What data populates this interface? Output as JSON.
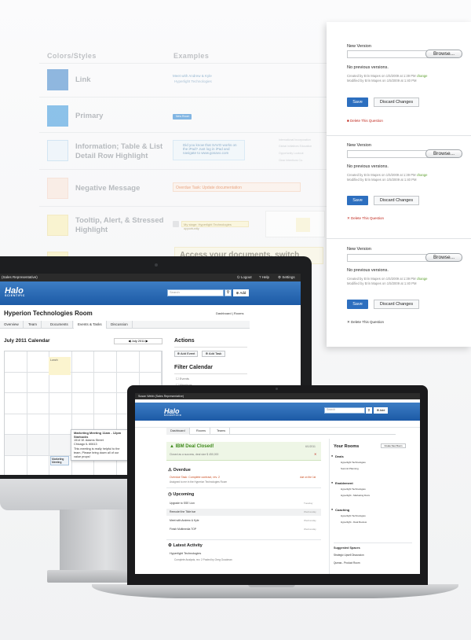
{
  "style_guide": {
    "col_colors": "Colors/Styles",
    "col_examples": "Examples",
    "rows": [
      {
        "name": "Link",
        "color": "#4f8fcf"
      },
      {
        "name": "Primary",
        "color": "#4aa0df"
      },
      {
        "name": "Information; Table & List\nDetail Row Highlight",
        "color": "#eaf4fb"
      },
      {
        "name": "Negative Message",
        "color": "#fbe7dc"
      },
      {
        "name": "Tooltip, Alert, & Stressed\nHighlight",
        "color": "#fbf1b8"
      }
    ],
    "link_example": "Meet with Andrew & Kyle",
    "link_sub": "Hyperlight Technologies",
    "primary_btn": "New Room",
    "info_text": "Did you know that SAVO works on the iPad? Just log in iPad and navigate to www.gosavo.com",
    "overdue_text": "Overdue Task: Update documentation",
    "tooltip_text": "My stage: Hyperlight Technologies opportunity",
    "doc_text": "Access your documents, switch",
    "mini_list": [
      "International Incorporation",
      "Global Initiatives Education",
      "Opportunity Lookout",
      "Clear Intentions Co."
    ]
  },
  "versions_panel": {
    "sections": [
      {
        "label": "New Version",
        "browse": "Browse...",
        "no_prev": "No previous versions.",
        "created": "Created by Erin Mapes on 1/5/2009 at 1:39 PM",
        "change": "change",
        "modified": "Modified by Erin Mapes on 1/5/2009 at 1:40 PM",
        "save": "Save",
        "discard": "Discard Changes",
        "delete": "Delete This Question",
        "delete_color": "#c0281d"
      },
      {
        "label": "New Version",
        "browse": "Browse...",
        "no_prev": "No previous versions.",
        "created": "Created by Erin Mapes on 1/5/2009 at 1:39 PM",
        "change": "change",
        "modified": "Modified by Erin Mapes on 1/5/2009 at 1:40 PM",
        "save": "Save",
        "discard": "Discard Changes",
        "delete": "Delete This Question",
        "delete_color": "#c0281d"
      },
      {
        "label": "New Version",
        "browse": "Browse...",
        "no_prev": "No previous versions.",
        "created": "Created by Erin Mapes on 1/5/2009 at 1:39 PM",
        "change": "change",
        "modified": "Modified by Erin Mapes on 1/5/2009 at 1:40 PM",
        "save": "Save",
        "discard": "Discard Changes",
        "delete": "Delete This Question",
        "delete_color": "#333333"
      }
    ]
  },
  "imac_app": {
    "user": "(Sales Representative)",
    "logout": "Logout",
    "help": "Help",
    "settings": "Settings",
    "logo": "Halo",
    "logo_sub": "SCIENTIFIC",
    "search_placeholder": "Search",
    "add": "Add",
    "room_title": "Hyperion Technologies Room",
    "crumbs": "Dashboard  |  Rooms",
    "tabs": [
      "Overview",
      "Team",
      "Documents",
      "Events & Tasks",
      "Discussion"
    ],
    "calendar_title": "July 2011 Calendar",
    "month": "July 2011",
    "actions": "Actions",
    "add_event": "Add Event",
    "add_task": "Add Task",
    "filter": "Filter Calendar",
    "filter_items": [
      "Events",
      "Meetings"
    ],
    "event_title": "Marketing Meeting 11am - 12pm",
    "event_where": "Starbucks",
    "event_addr1": "1514 W. Adams Street",
    "event_addr2": "Chicago IL 60613",
    "event_note": "This meeting is really helpful to the team, Please bring down all of our value props!",
    "event_chip": "Marketing Meeting",
    "cell_note": "Lunch"
  },
  "laptop_app": {
    "user": "Susan Webb (Sales Representative)",
    "logo": "Halo",
    "logo_sub": "SCIENTIFIC",
    "search_placeholder": "Search",
    "add": "Add",
    "tabs": [
      "Dashboard",
      "Rooms",
      "Teams"
    ],
    "deal_title": "IBM Deal Closed!",
    "deal_date": "6/1/2011",
    "deal_sub": "Closed as a success, deal size $ 450,000",
    "overdue": "Overdue",
    "overdue_item": "Overdue Task: Complete contract, rev. 2",
    "overdue_due": "due on the 1st",
    "overdue_meta": "Assigned to me in the Hyperion Technologies Room",
    "upcoming": "Upcoming",
    "upcoming_items": [
      {
        "name": "Upgrade to SSE Lion",
        "when": "Tuesday"
      },
      {
        "name": "Remodel the Tilde bar",
        "when": "Wednesday"
      },
      {
        "name": "Meet with Andrew & Kyle",
        "when": "Wednesday"
      },
      {
        "name": "Finish Multimedia TOP",
        "when": "Wednesday"
      }
    ],
    "latest": "Latest Activity",
    "activity_1": "Hyperlight Technologies",
    "activity_2": "Complete Analysis, rev. 2   Posted by Greg Goodman",
    "your_rooms": "Your Rooms",
    "create_room": "Create New Room",
    "room_groups": [
      {
        "name": "Deals",
        "items": [
          "Hyperlight Technologies",
          "Summit Planning"
        ]
      },
      {
        "name": "Enablement",
        "items": [
          "Hyperlight Technologies",
          "Hyperlight - Marketing Docs"
        ]
      },
      {
        "name": "Coaching",
        "items": [
          "Hyperlight Technologies",
          "Hyperlight - Deal Review"
        ]
      }
    ],
    "suggested": "Suggested Spaces",
    "suggested_items": [
      "Strategic Upsell Discussion",
      "Qumas - Product Room"
    ]
  }
}
